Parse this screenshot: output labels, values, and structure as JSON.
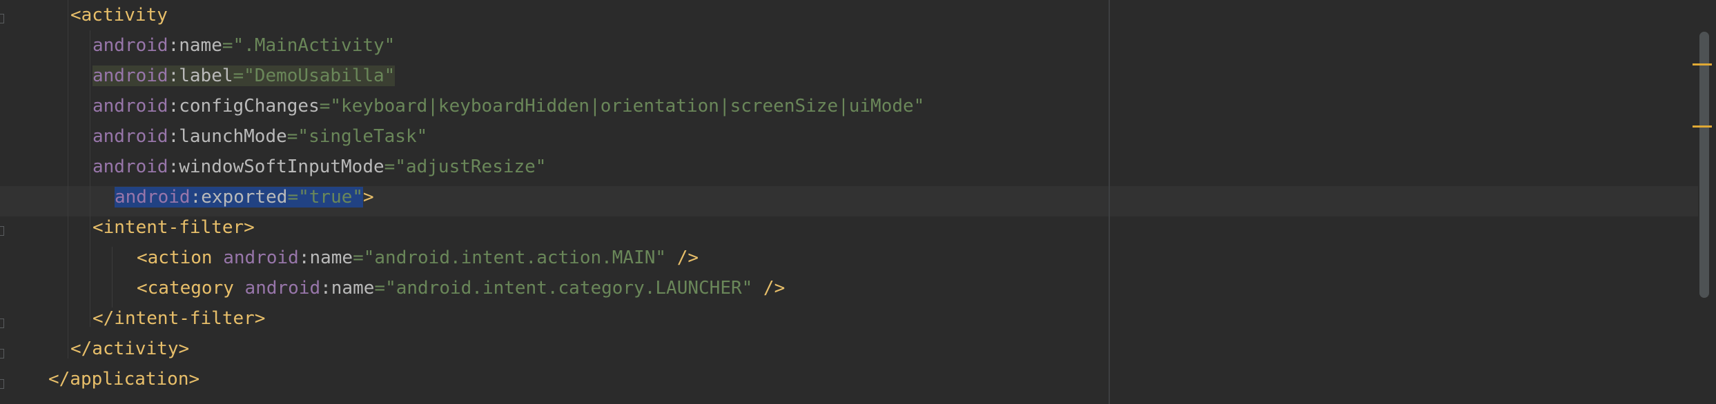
{
  "editor": {
    "lines": [
      [
        {
          "c": "tag",
          "t": "<activity"
        }
      ],
      [
        {
          "c": "ns",
          "t": "android"
        },
        {
          "c": "attr",
          "t": ":name"
        },
        {
          "c": "eq",
          "t": "="
        },
        {
          "c": "str",
          "t": "\".MainActivity\""
        }
      ],
      [
        {
          "c": "ns",
          "t": "android"
        },
        {
          "c": "attr",
          "t": ":label"
        },
        {
          "c": "eq",
          "t": "="
        },
        {
          "c": "str",
          "t": "\"DemoUsabilla\""
        }
      ],
      [
        {
          "c": "ns",
          "t": "android"
        },
        {
          "c": "attr",
          "t": ":configChanges"
        },
        {
          "c": "eq",
          "t": "="
        },
        {
          "c": "str",
          "t": "\"keyboard|keyboardHidden|orientation|screenSize|uiMode\""
        }
      ],
      [
        {
          "c": "ns",
          "t": "android"
        },
        {
          "c": "attr",
          "t": ":launchMode"
        },
        {
          "c": "eq",
          "t": "="
        },
        {
          "c": "str",
          "t": "\"singleTask\""
        }
      ],
      [
        {
          "c": "ns",
          "t": "android"
        },
        {
          "c": "attr",
          "t": ":windowSoftInputMode"
        },
        {
          "c": "eq",
          "t": "="
        },
        {
          "c": "str",
          "t": "\"adjustResize\""
        }
      ],
      [
        {
          "c": "ns",
          "t": "android"
        },
        {
          "c": "attr",
          "t": ":exported"
        },
        {
          "c": "eq",
          "t": "="
        },
        {
          "c": "str",
          "t": "\"true\""
        },
        {
          "c": "tag",
          "t": ">"
        }
      ],
      [
        {
          "c": "tag",
          "t": "<intent-filter>"
        }
      ],
      [
        {
          "c": "tag",
          "t": "<action "
        },
        {
          "c": "ns",
          "t": "android"
        },
        {
          "c": "attr",
          "t": ":name"
        },
        {
          "c": "eq",
          "t": "="
        },
        {
          "c": "str",
          "t": "\"android.intent.action.MAIN\""
        },
        {
          "c": "tag",
          "t": " />"
        }
      ],
      [
        {
          "c": "tag",
          "t": "<category "
        },
        {
          "c": "ns",
          "t": "android"
        },
        {
          "c": "attr",
          "t": ":name"
        },
        {
          "c": "eq",
          "t": "="
        },
        {
          "c": "str",
          "t": "\"android.intent.category.LAUNCHER\""
        },
        {
          "c": "tag",
          "t": " />"
        }
      ],
      [
        {
          "c": "tag",
          "t": "</intent-filter>"
        }
      ],
      [
        {
          "c": "tag",
          "t": "</activity>"
        }
      ],
      [
        {
          "c": "tag",
          "t": "</application>"
        }
      ]
    ]
  },
  "colors": {
    "background": "#2b2b2b",
    "tag": "#e8bf6a",
    "namespace": "#9876aa",
    "attribute": "#bababa",
    "string": "#6a8759",
    "selection": "#214283",
    "scroll_marker": "#e0a935"
  }
}
